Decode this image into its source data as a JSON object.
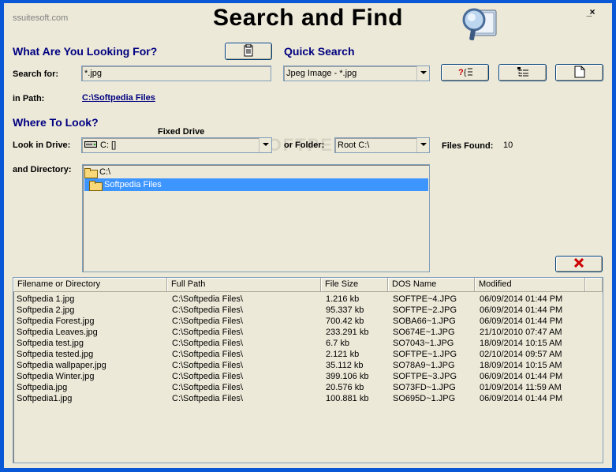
{
  "window": {
    "brand": "ssuitesoft.com",
    "title": "Search and Find",
    "minimize": "_",
    "close": "×",
    "watermark": "SOFTPEDIA"
  },
  "looking_for": {
    "heading": "What Are You Looking For?",
    "search_label": "Search for:",
    "search_value": "*.jpg",
    "path_label": "in Path:",
    "path_value": "C:\\Softpedia Files"
  },
  "quick_search": {
    "heading": "Quick Search",
    "selected": "Jpeg Image - *.jpg"
  },
  "where": {
    "heading": "Where To Look?",
    "drive_label": "Look in Drive:",
    "drive_caption": "Fixed Drive",
    "drive_value": "C: []",
    "folder_label": "or Folder:",
    "folder_value": "Root C:\\",
    "files_found_label": "Files Found:",
    "files_found_value": "10",
    "directory_label": "and Directory:",
    "directories": [
      "C:\\",
      "Softpedia Files"
    ]
  },
  "results": {
    "columns": [
      "Filename or Directory",
      "Full Path",
      "File Size",
      "DOS Name",
      "Modified"
    ],
    "rows": [
      [
        "Softpedia 1.jpg",
        "C:\\Softpedia Files\\",
        "1.216 kb",
        "SOFTPE~4.JPG",
        "06/09/2014 01:44 PM"
      ],
      [
        "Softpedia 2.jpg",
        "C:\\Softpedia Files\\",
        "95.337 kb",
        "SOFTPE~2.JPG",
        "06/09/2014 01:44 PM"
      ],
      [
        "Softpedia Forest.jpg",
        "C:\\Softpedia Files\\",
        "700.42 kb",
        "SOBA66~1.JPG",
        "06/09/2014 01:44 PM"
      ],
      [
        "Softpedia Leaves.jpg",
        "C:\\Softpedia Files\\",
        "233.291 kb",
        "SO674E~1.JPG",
        "21/10/2010 07:47 AM"
      ],
      [
        "Softpedia test.jpg",
        "C:\\Softpedia Files\\",
        "6.7 kb",
        "SO7043~1.JPG",
        "18/09/2014 10:15 AM"
      ],
      [
        "Softpedia tested.jpg",
        "C:\\Softpedia Files\\",
        "2.121 kb",
        "SOFTPE~1.JPG",
        "02/10/2014 09:57 AM"
      ],
      [
        "Softpedia wallpaper.jpg",
        "C:\\Softpedia Files\\",
        "35.112 kb",
        "SO78A9~1.JPG",
        "18/09/2014 10:15 AM"
      ],
      [
        "Softpedia Winter.jpg",
        "C:\\Softpedia Files\\",
        "399.106 kb",
        "SOFTPE~3.JPG",
        "06/09/2014 01:44 PM"
      ],
      [
        "Softpedia.jpg",
        "C:\\Softpedia Files\\",
        "20.576 kb",
        "SO73FD~1.JPG",
        "01/09/2014 11:59 AM"
      ],
      [
        "Softpedia1.jpg",
        "C:\\Softpedia Files\\",
        "100.881 kb",
        "SO695D~1.JPG",
        "06/09/2014 01:44 PM"
      ]
    ]
  },
  "colors": {
    "frame": "#0a58d6",
    "window_bg": "#ece9d8",
    "heading": "#000080",
    "selection": "#3d95ff",
    "delete": "#cc0000"
  }
}
